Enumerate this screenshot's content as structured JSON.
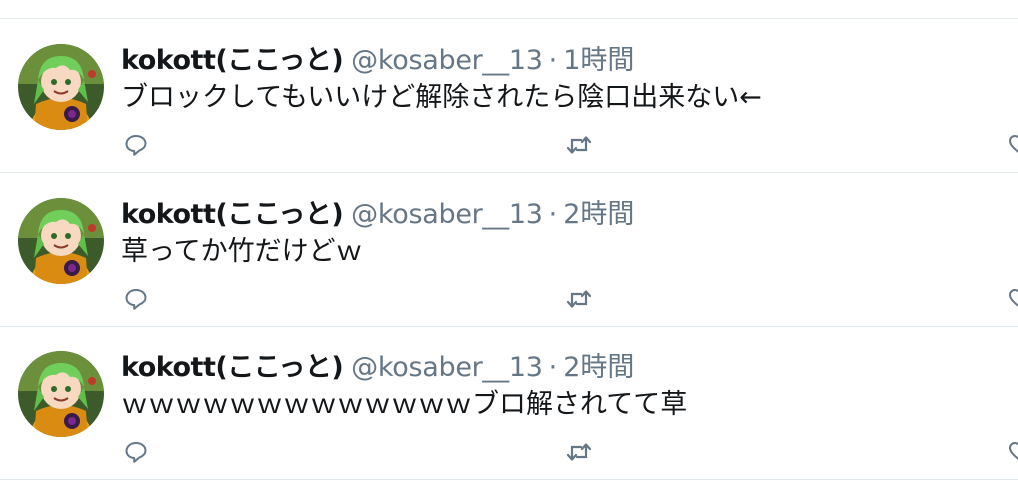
{
  "tweets": [
    {
      "display_name": "kokott(ここっと)",
      "handle": "@kosaber__13",
      "separator": "·",
      "time": "1時間",
      "text": "ブロックしてもいいけど解除されたら陰口出来ない←"
    },
    {
      "display_name": "kokott(ここっと)",
      "handle": "@kosaber__13",
      "separator": "·",
      "time": "2時間",
      "text": "草ってか竹だけどｗ"
    },
    {
      "display_name": "kokott(ここっと)",
      "handle": "@kosaber__13",
      "separator": "·",
      "time": "2時間",
      "text": "ｗｗｗｗｗｗｗｗｗｗｗｗｗブロ解されてて草"
    }
  ],
  "icons": {
    "avatar": "avatar-image",
    "reply": "reply-icon",
    "retweet": "retweet-icon",
    "like": "like-icon"
  },
  "colors": {
    "text_primary": "#14171a",
    "text_secondary": "#657786",
    "divider": "#e1e8ed",
    "icon": "#657786"
  }
}
